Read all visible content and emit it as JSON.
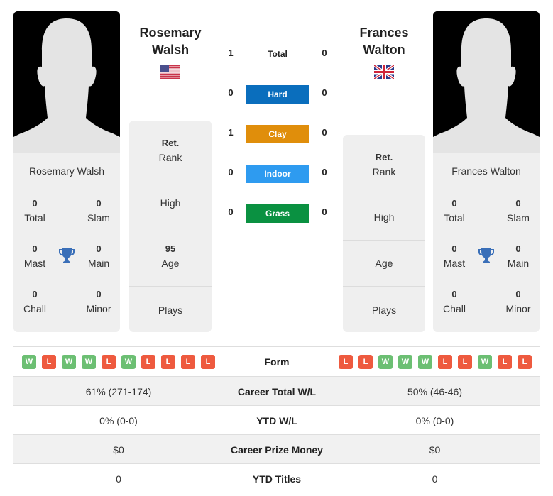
{
  "players": [
    {
      "name": "Rosemary Walsh",
      "name_line1": "Rosemary",
      "name_line2": "Walsh",
      "country_flag": "us-flag-icon",
      "titles": {
        "total": {
          "value": "0",
          "label": "Total"
        },
        "slam": {
          "value": "0",
          "label": "Slam"
        },
        "mast": {
          "value": "0",
          "label": "Mast"
        },
        "main": {
          "value": "0",
          "label": "Main"
        },
        "chall": {
          "value": "0",
          "label": "Chall"
        },
        "minor": {
          "value": "0",
          "label": "Minor"
        }
      },
      "info": {
        "rank": {
          "value": "Ret.",
          "label": "Rank"
        },
        "high": {
          "value": "",
          "label": "High"
        },
        "age": {
          "value": "95",
          "label": "Age"
        },
        "plays": {
          "value": "",
          "label": "Plays"
        }
      },
      "form": [
        "W",
        "L",
        "W",
        "W",
        "L",
        "W",
        "L",
        "L",
        "L",
        "L"
      ]
    },
    {
      "name": "Frances Walton",
      "name_line1": "Frances",
      "name_line2": "Walton",
      "country_flag": "uk-flag-icon",
      "titles": {
        "total": {
          "value": "0",
          "label": "Total"
        },
        "slam": {
          "value": "0",
          "label": "Slam"
        },
        "mast": {
          "value": "0",
          "label": "Mast"
        },
        "main": {
          "value": "0",
          "label": "Main"
        },
        "chall": {
          "value": "0",
          "label": "Chall"
        },
        "minor": {
          "value": "0",
          "label": "Minor"
        }
      },
      "info": {
        "rank": {
          "value": "Ret.",
          "label": "Rank"
        },
        "high": {
          "value": "",
          "label": "High"
        },
        "age": {
          "value": "",
          "label": "Age"
        },
        "plays": {
          "value": "",
          "label": "Plays"
        }
      },
      "form": [
        "L",
        "L",
        "W",
        "W",
        "W",
        "L",
        "L",
        "W",
        "L",
        "L"
      ]
    }
  ],
  "h2h": {
    "total": {
      "label": "Total",
      "left": "1",
      "right": "0"
    },
    "surfaces": [
      {
        "label": "Hard",
        "left": "0",
        "right": "0",
        "color": "#0a6ebd"
      },
      {
        "label": "Clay",
        "left": "1",
        "right": "0",
        "color": "#e08e0b"
      },
      {
        "label": "Indoor",
        "left": "0",
        "right": "0",
        "color": "#2e9bf0"
      },
      {
        "label": "Grass",
        "left": "0",
        "right": "0",
        "color": "#0a9141"
      }
    ]
  },
  "comparison": {
    "form_label": "Form",
    "rows": [
      {
        "label": "Career Total W/L",
        "left": "61% (271-174)",
        "right": "50% (46-46)"
      },
      {
        "label": "YTD W/L",
        "left": "0% (0-0)",
        "right": "0% (0-0)"
      },
      {
        "label": "Career Prize Money",
        "left": "$0",
        "right": "$0"
      },
      {
        "label": "YTD Titles",
        "left": "0",
        "right": "0"
      }
    ]
  },
  "colors": {
    "win": "#6cbf73",
    "loss": "#ee5a3f",
    "trophy": "#3a6fb8"
  }
}
